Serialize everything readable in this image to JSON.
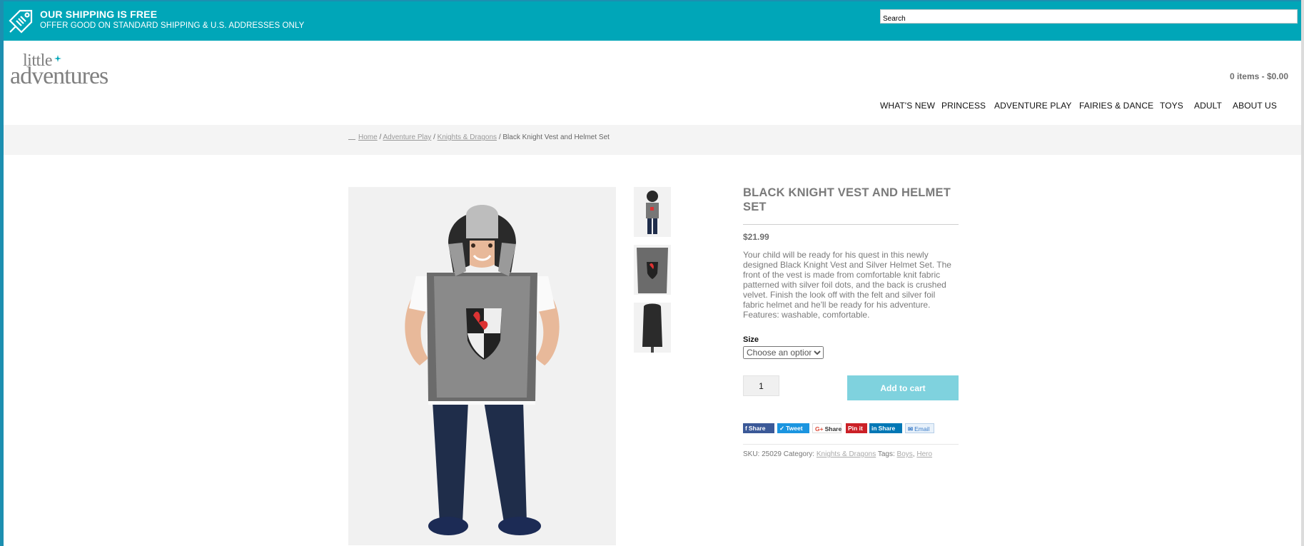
{
  "promo": {
    "headline": "OUR SHIPPING IS FREE",
    "subline": "OFFER GOOD ON STANDARD SHIPPING & U.S. ADDRESSES ONLY",
    "icon": "shipping-tag-icon"
  },
  "search": {
    "placeholder": "Search"
  },
  "logo": {
    "word1": "little",
    "word2": "adventures"
  },
  "cart": {
    "summary": "0 items - $0.00"
  },
  "nav": {
    "items": [
      {
        "label": "WHAT'S NEW"
      },
      {
        "label": "PRINCESS"
      },
      {
        "label": "ADVENTURE PLAY"
      },
      {
        "label": "FAIRIES & DANCE"
      },
      {
        "label": "TOYS"
      },
      {
        "label": "ADULT"
      },
      {
        "label": "ABOUT US"
      }
    ]
  },
  "breadcrumb": {
    "items": [
      "Home",
      "Adventure Play",
      "Knights & Dragons"
    ],
    "separator": "/",
    "current": "Black Knight Vest and Helmet Set"
  },
  "product": {
    "title": "BLACK KNIGHT VEST AND HELMET SET",
    "price": "$21.99",
    "description": "Your child will be ready for his quest in this newly designed Black Knight Vest and Silver Helmet Set. The front of the vest is made from comfortable knit fabric patterned with silver foil dots, and the back is crushed velvet. Finish the look off with the felt and silver foil fabric helmet and he'll be ready for his adventure. Features: washable, comfortable.",
    "size_label": "Size",
    "size_selected": "Choose an option",
    "quantity": "1",
    "add_to_cart": "Add to cart"
  },
  "share": {
    "facebook": "Share",
    "twitter": "Tweet",
    "google": "Share",
    "pinterest": "Pin it",
    "linkedin": "Share",
    "email": "Email"
  },
  "meta": {
    "sku_label": "SKU:",
    "sku": "25029",
    "category_label": "Category:",
    "category": "Knights & Dragons",
    "tags_label": "Tags:",
    "tags": [
      "Boys",
      "Hero"
    ]
  },
  "colors": {
    "promo_bg": "#00a6b8",
    "add_to_cart_bg": "#7fd2de",
    "facebook": "#3b5998",
    "twitter": "#1b95e0",
    "pinterest": "#cb2027",
    "linkedin": "#0077b5"
  }
}
